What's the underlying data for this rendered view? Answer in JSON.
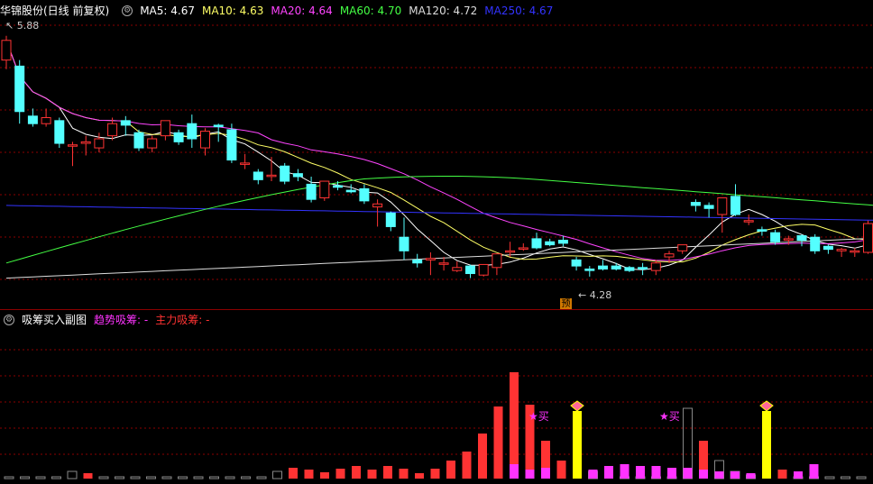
{
  "main_header": {
    "title": "华锦股份(日线 前复权)",
    "ma": [
      {
        "label": "MA5: 4.67",
        "color": "#ffffff"
      },
      {
        "label": "MA10: 4.63",
        "color": "#ffff66"
      },
      {
        "label": "MA20: 4.64",
        "color": "#ff44ff"
      },
      {
        "label": "MA60: 4.70",
        "color": "#44ff44"
      },
      {
        "label": "MA120: 4.72",
        "color": "#dddddd"
      },
      {
        "label": "MA250: 4.67",
        "color": "#3333ff"
      }
    ]
  },
  "annotations": {
    "high": "5.88",
    "low": "4.28",
    "pre_tag": "预"
  },
  "sub_header": {
    "title": "吸筹买入副图",
    "trend": "趋势吸筹: -",
    "main": "主力吸筹: -"
  },
  "buy_label": "买",
  "colors": {
    "up": "#ff3333",
    "down": "#54ffff",
    "grid": "#8b0000",
    "magenta": "#ff33ff",
    "yellow": "#ffff00"
  },
  "chart_data": [
    {
      "type": "candlestick",
      "ylim": [
        4.2,
        5.95
      ],
      "candles": [
        [
          5.72,
          5.88,
          5.85,
          5.66
        ],
        [
          5.68,
          5.72,
          5.38,
          5.3
        ],
        [
          5.35,
          5.4,
          5.3,
          5.28
        ],
        [
          5.3,
          5.4,
          5.34,
          5.28
        ],
        [
          5.32,
          5.34,
          5.17,
          5.14
        ],
        [
          5.16,
          5.18,
          5.16,
          5.02
        ],
        [
          5.17,
          5.22,
          5.18,
          5.09
        ],
        [
          5.14,
          5.24,
          5.2,
          5.11
        ],
        [
          5.22,
          5.34,
          5.3,
          5.19
        ],
        [
          5.32,
          5.35,
          5.29,
          5.22
        ],
        [
          5.24,
          5.26,
          5.14,
          5.12
        ],
        [
          5.14,
          5.22,
          5.2,
          5.11
        ],
        [
          5.22,
          5.32,
          5.32,
          5.19
        ],
        [
          5.24,
          5.26,
          5.18,
          5.16
        ],
        [
          5.3,
          5.36,
          5.2,
          5.14
        ],
        [
          5.14,
          5.27,
          5.25,
          5.09
        ],
        [
          5.29,
          5.3,
          5.28,
          5.18
        ],
        [
          5.26,
          5.3,
          5.06,
          5.04
        ],
        [
          5.04,
          5.1,
          5.04,
          5.0
        ],
        [
          4.98,
          5.0,
          4.93,
          4.9
        ],
        [
          4.96,
          5.08,
          4.96,
          4.92
        ],
        [
          5.02,
          5.04,
          4.92,
          4.9
        ],
        [
          4.97,
          5.0,
          4.95,
          4.92
        ],
        [
          4.9,
          4.95,
          4.8,
          4.78
        ],
        [
          4.81,
          4.92,
          4.92,
          4.79
        ],
        [
          4.89,
          4.92,
          4.88,
          4.86
        ],
        [
          4.86,
          4.9,
          4.85,
          4.84
        ],
        [
          4.87,
          4.9,
          4.79,
          4.77
        ],
        [
          4.75,
          4.8,
          4.77,
          4.62
        ],
        [
          4.71,
          4.72,
          4.62,
          4.59
        ],
        [
          4.55,
          4.68,
          4.46,
          4.4
        ],
        [
          4.4,
          4.44,
          4.38,
          4.35
        ],
        [
          4.4,
          4.45,
          4.41,
          4.3
        ],
        [
          4.38,
          4.42,
          4.38,
          4.33
        ],
        [
          4.33,
          4.39,
          4.35,
          4.32
        ],
        [
          4.36,
          4.37,
          4.31,
          4.28
        ],
        [
          4.3,
          4.36,
          4.37,
          4.29
        ],
        [
          4.35,
          4.42,
          4.44,
          4.3
        ],
        [
          4.46,
          4.52,
          4.46,
          4.42
        ],
        [
          4.48,
          4.51,
          4.48,
          4.46
        ],
        [
          4.54,
          4.58,
          4.48,
          4.47
        ],
        [
          4.52,
          4.54,
          4.5,
          4.49
        ],
        [
          4.53,
          4.56,
          4.51,
          4.49
        ],
        [
          4.4,
          4.42,
          4.36,
          4.33
        ],
        [
          4.34,
          4.36,
          4.33,
          4.29
        ],
        [
          4.36,
          4.4,
          4.34,
          4.33
        ],
        [
          4.36,
          4.38,
          4.34,
          4.33
        ],
        [
          4.35,
          4.36,
          4.33,
          4.32
        ],
        [
          4.35,
          4.38,
          4.34,
          4.3
        ],
        [
          4.33,
          4.4,
          4.38,
          4.3
        ],
        [
          4.42,
          4.46,
          4.44,
          4.38
        ],
        [
          4.46,
          4.48,
          4.5,
          4.44
        ],
        [
          4.78,
          4.8,
          4.76,
          4.72
        ],
        [
          4.76,
          4.78,
          4.74,
          4.68
        ],
        [
          4.7,
          4.81,
          4.81,
          4.58
        ],
        [
          4.82,
          4.9,
          4.7,
          4.69
        ],
        [
          4.66,
          4.7,
          4.66,
          4.63
        ],
        [
          4.6,
          4.62,
          4.59,
          4.56
        ],
        [
          4.58,
          4.6,
          4.52,
          4.5
        ],
        [
          4.54,
          4.56,
          4.54,
          4.5
        ],
        [
          4.56,
          4.57,
          4.53,
          4.49
        ],
        [
          4.55,
          4.57,
          4.46,
          4.44
        ],
        [
          4.49,
          4.5,
          4.47,
          4.44
        ],
        [
          4.46,
          4.48,
          4.47,
          4.42
        ],
        [
          4.46,
          4.48,
          4.46,
          4.42
        ],
        [
          4.45,
          4.66,
          4.64,
          4.44
        ],
        [
          4.61,
          4.63,
          4.62,
          4.58
        ],
        [
          4.68,
          4.78,
          4.68,
          4.62
        ]
      ]
    },
    {
      "type": "bar",
      "bars": [
        [
          "g",
          2
        ],
        [
          "g",
          2
        ],
        [
          "g",
          2
        ],
        [
          "g",
          2
        ],
        [
          "g",
          8
        ],
        [
          "r",
          6
        ],
        [
          "g",
          2
        ],
        [
          "g",
          2
        ],
        [
          "g",
          2
        ],
        [
          "g",
          2
        ],
        [
          "g",
          2
        ],
        [
          "g",
          2
        ],
        [
          "g",
          2
        ],
        [
          "g",
          2
        ],
        [
          "g",
          2
        ],
        [
          "g",
          2
        ],
        [
          "g",
          2
        ],
        [
          "g",
          8
        ],
        [
          "r",
          12
        ],
        [
          "r",
          10
        ],
        [
          "r",
          7
        ],
        [
          "r",
          11
        ],
        [
          "r",
          14
        ],
        [
          "r",
          10
        ],
        [
          "r",
          14
        ],
        [
          "r",
          11
        ],
        [
          "r",
          6
        ],
        [
          "r",
          11
        ],
        [
          "r",
          20
        ],
        [
          "r",
          30
        ],
        [
          "r",
          50
        ],
        [
          "r",
          80
        ],
        [
          "r",
          118
        ],
        [
          "r",
          82
        ],
        [
          "r",
          42
        ],
        [
          "r",
          20
        ],
        [
          "y",
          75
        ],
        [
          "g",
          8
        ],
        [
          "r",
          2
        ],
        [
          "g",
          2
        ],
        [
          "g",
          2
        ],
        [
          "g",
          2
        ],
        [
          "g",
          2
        ],
        [
          "g",
          78
        ],
        [
          "r",
          42
        ],
        [
          "g",
          20
        ],
        [
          "g",
          8
        ],
        [
          "g",
          4
        ],
        [
          "y",
          75
        ],
        [
          "r",
          10
        ],
        [
          "g",
          2
        ],
        [
          "g",
          2
        ],
        [
          "g",
          2
        ],
        [
          "g",
          2
        ],
        [
          "g",
          2
        ]
      ],
      "magenta_overlay": [
        0,
        0,
        0,
        0,
        0,
        0,
        0,
        0,
        0,
        0,
        0,
        0,
        0,
        0,
        0,
        0,
        0,
        0,
        0,
        0,
        0,
        0,
        0,
        0,
        0,
        0,
        0,
        0,
        0,
        0,
        0,
        0,
        16,
        10,
        12,
        0,
        0,
        10,
        14,
        16,
        14,
        14,
        12,
        12,
        10,
        8,
        8,
        6,
        0,
        0,
        8,
        16,
        0,
        0,
        0
      ]
    }
  ]
}
